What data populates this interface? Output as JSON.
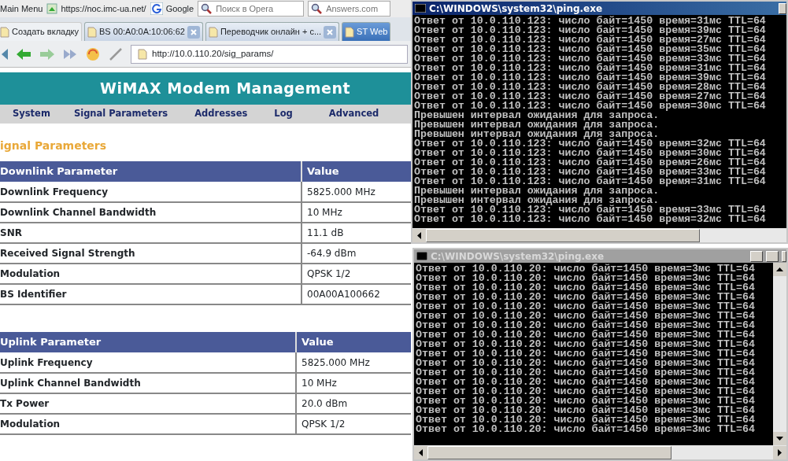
{
  "browser": {
    "menu_button": "Main Menu",
    "bookmarks": [
      {
        "kind": "page",
        "label": "https://noc.imc-ua.net/"
      },
      {
        "kind": "google",
        "label": "Google"
      }
    ],
    "search_fields": [
      {
        "placeholder": "Поиск в Opera"
      },
      {
        "placeholder": "Answers.com"
      }
    ],
    "tabs": [
      {
        "label": "Создать вкладку",
        "selected": false,
        "closable": false
      },
      {
        "label": "BS 00:A0:0A:10:06:62",
        "selected": false,
        "closable": true
      },
      {
        "label": "Переводчик онлайн + с...",
        "selected": false,
        "closable": true
      },
      {
        "label": "ST Web",
        "selected": true,
        "closable": false
      }
    ],
    "address": "http://10.0.110.20/sig_params/"
  },
  "page": {
    "title": "WiMAX Modem Management",
    "nav": [
      {
        "label": "System"
      },
      {
        "label": "Signal Parameters"
      },
      {
        "label": "Addresses"
      },
      {
        "label": "Log"
      },
      {
        "label": "Advanced"
      }
    ],
    "section_title": "ignal Parameters",
    "tables": [
      {
        "columns": [
          "Downlink Parameter",
          "Value"
        ],
        "rows": [
          [
            "Downlink Frequency",
            "5825.000 MHz"
          ],
          [
            "Downlink Channel Bandwidth",
            "10 MHz"
          ],
          [
            "SNR",
            "11.1 dB"
          ],
          [
            "Received Signal Strength",
            "-64.9 dBm"
          ],
          [
            "Modulation",
            "QPSK 1/2"
          ],
          [
            "BS Identifier",
            "00A00A100662"
          ]
        ]
      },
      {
        "columns": [
          "Uplink Parameter",
          "Value"
        ],
        "rows": [
          [
            "Uplink Frequency",
            "5825.000 MHz"
          ],
          [
            "Uplink Channel Bandwidth",
            "10 MHz"
          ],
          [
            "Tx Power",
            "20.0 dBm"
          ],
          [
            "Modulation",
            "QPSK 1/2"
          ]
        ]
      }
    ]
  },
  "consoles": [
    {
      "title": "C:\\WINDOWS\\system32\\ping.exe",
      "active": true,
      "lines": [
        "Ответ от 10.0.110.123: число байт=1450 время=31мс TTL=64",
        "Ответ от 10.0.110.123: число байт=1450 время=39мс TTL=64",
        "Ответ от 10.0.110.123: число байт=1450 время=27мс TTL=64",
        "Ответ от 10.0.110.123: число байт=1450 время=35мс TTL=64",
        "Ответ от 10.0.110.123: число байт=1450 время=33мс TTL=64",
        "Ответ от 10.0.110.123: число байт=1450 время=31мс TTL=64",
        "Ответ от 10.0.110.123: число байт=1450 время=39мс TTL=64",
        "Ответ от 10.0.110.123: число байт=1450 время=28мс TTL=64",
        "Ответ от 10.0.110.123: число байт=1450 время=27мс TTL=64",
        "Ответ от 10.0.110.123: число байт=1450 время=30мс TTL=64",
        "Превышен интервал ожидания для запроса.",
        "Превышен интервал ожидания для запроса.",
        "Превышен интервал ожидания для запроса.",
        "Ответ от 10.0.110.123: число байт=1450 время=32мс TTL=64",
        "Ответ от 10.0.110.123: число байт=1450 время=30мс TTL=64",
        "Ответ от 10.0.110.123: число байт=1450 время=26мс TTL=64",
        "Ответ от 10.0.110.123: число байт=1450 время=33мс TTL=64",
        "Ответ от 10.0.110.123: число байт=1450 время=31мс TTL=64",
        "Превышен интервал ожидания для запроса.",
        "Превышен интервал ожидания для запроса.",
        "Ответ от 10.0.110.123: число байт=1450 время=33мс TTL=64",
        "Ответ от 10.0.110.123: число байт=1450 время=32мс TTL=64"
      ]
    },
    {
      "title": "C:\\WINDOWS\\system32\\ping.exe",
      "active": false,
      "lines": [
        "Ответ от 10.0.110.20: число байт=1450 время=3мс TTL=64",
        "Ответ от 10.0.110.20: число байт=1450 время=3мс TTL=64",
        "Ответ от 10.0.110.20: число байт=1450 время=3мс TTL=64",
        "Ответ от 10.0.110.20: число байт=1450 время=3мс TTL=64",
        "Ответ от 10.0.110.20: число байт=1450 время=3мс TTL=64",
        "Ответ от 10.0.110.20: число байт=1450 время=3мс TTL=64",
        "Ответ от 10.0.110.20: число байт=1450 время=3мс TTL=64",
        "Ответ от 10.0.110.20: число байт=1450 время=3мс TTL=64",
        "Ответ от 10.0.110.20: число байт=1450 время=3мс TTL=64",
        "Ответ от 10.0.110.20: число байт=1450 время=3мс TTL=64",
        "Ответ от 10.0.110.20: число байт=1450 время=3мс TTL=64",
        "Ответ от 10.0.110.20: число байт=1450 время=3мс TTL=64",
        "Ответ от 10.0.110.20: число байт=1450 время=3мс TTL=64",
        "Ответ от 10.0.110.20: число байт=1450 время=3мс TTL=64",
        "Ответ от 10.0.110.20: число байт=1450 время=3мс TTL=64",
        "Ответ от 10.0.110.20: число байт=1450 время=3мс TTL=64",
        "Ответ от 10.0.110.20: число байт=1450 время=3мс TTL=64",
        "Ответ от 10.0.110.20: число байт=1450 время=3мс TTL=64"
      ]
    }
  ]
}
